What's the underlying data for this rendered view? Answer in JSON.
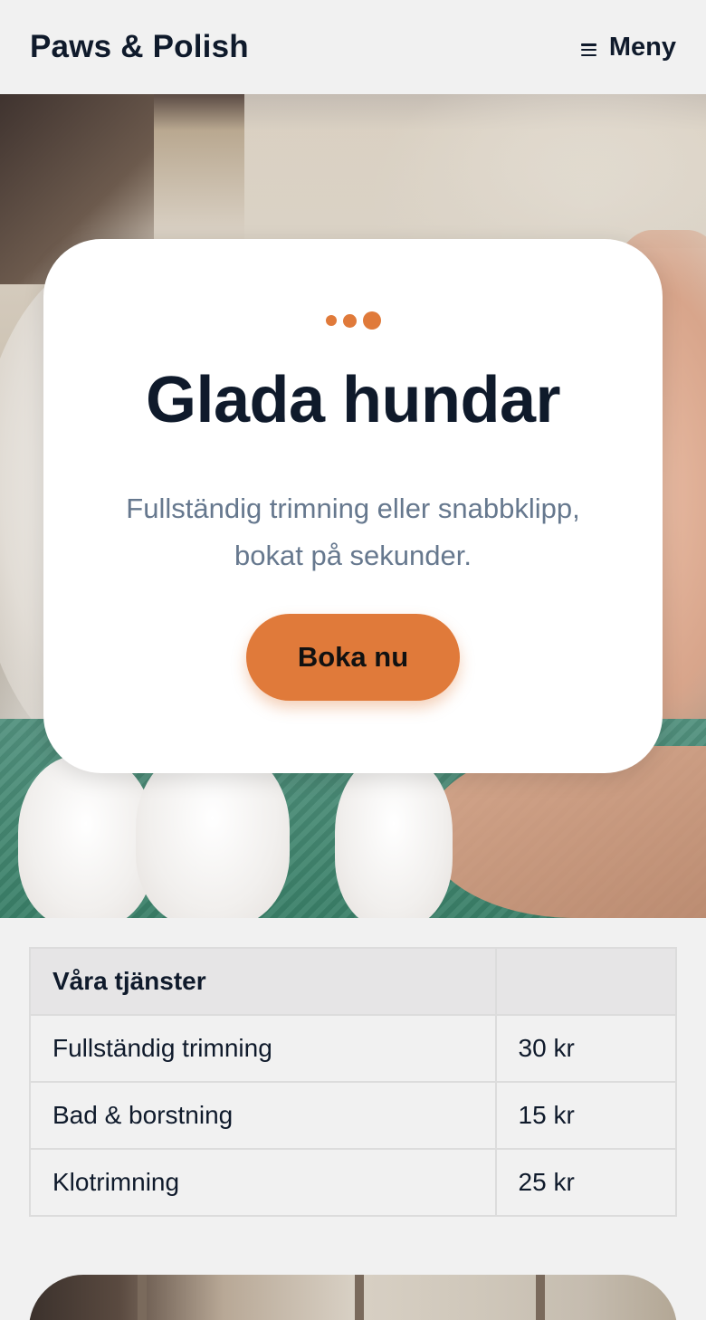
{
  "header": {
    "brand": "Paws & Polish",
    "menu_label": "Meny",
    "menu_icon": "hamburger-icon"
  },
  "hero": {
    "title": "Glada hundar",
    "subtitle": "Fullständig trimning eller snabbklipp, bokat på sekunder.",
    "cta_label": "Boka nu",
    "accent_color": "#e07a3a"
  },
  "services": {
    "heading": "Våra tjänster",
    "price_heading": "",
    "rows": [
      {
        "name": "Fullständig trimning",
        "price": "30 kr"
      },
      {
        "name": "Bad & borstning",
        "price": "15 kr"
      },
      {
        "name": "Klotrimning",
        "price": "25 kr"
      }
    ]
  }
}
